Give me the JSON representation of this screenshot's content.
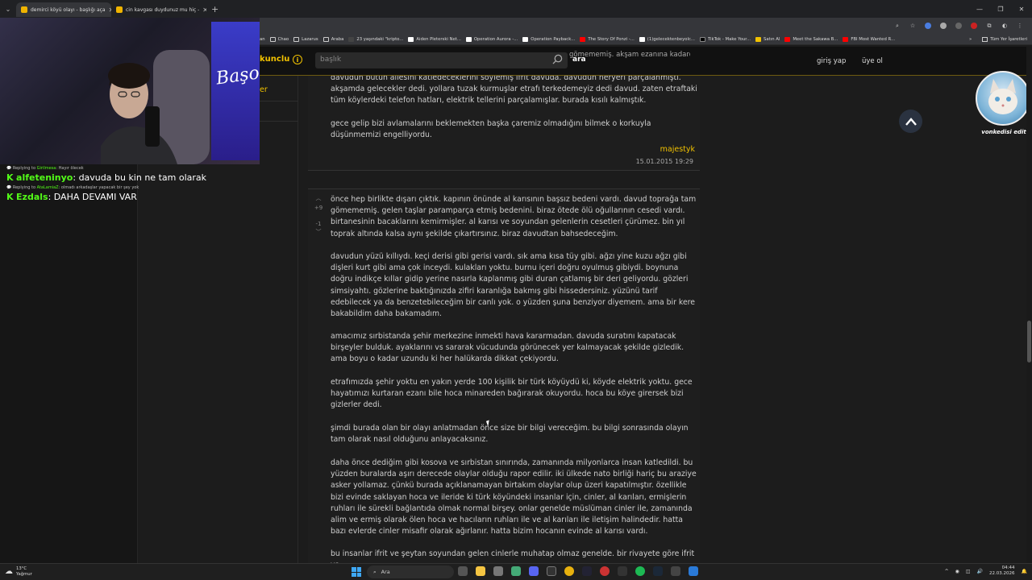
{
  "browser": {
    "tabs": [
      {
        "label": "demirci köyü olayı - başlığı aça",
        "active": true
      },
      {
        "label": "cin kavgası duydunuz mu hiç - ",
        "active": false
      }
    ],
    "new_tab": "+",
    "window_controls": [
      "—",
      "❐",
      "✕"
    ],
    "bookmarks": [
      {
        "label": "an",
        "color": "#888888"
      },
      {
        "label": "Chao",
        "color": "#cccccc"
      },
      {
        "label": "Lazarus",
        "color": "#cccccc"
      },
      {
        "label": "Araba",
        "color": "#cccccc"
      },
      {
        "label": "23 yaşındaki \"kripto...",
        "color": "#444444"
      },
      {
        "label": "Aiden Pleterski Net...",
        "color": "#ffffff"
      },
      {
        "label": "Operation Aurora -...",
        "color": "#ffffff"
      },
      {
        "label": "Operation Payback...",
        "color": "#ffffff"
      },
      {
        "label": "The Story Of Ponzi -...",
        "color": "#ff0000"
      },
      {
        "label": "(1)gelecektenbeyolc...",
        "color": "#ffffff"
      },
      {
        "label": "TikTok - Make Your...",
        "color": "#000000"
      },
      {
        "label": "Satın Al",
        "color": "#f2c200"
      },
      {
        "label": "Meet the Sakawa B...",
        "color": "#ff0000"
      },
      {
        "label": "FBI Most Wanted R...",
        "color": "#ff0000"
      }
    ],
    "bookmarks_more": "»",
    "all_bookmarks": "Tüm Yer İşaretleri"
  },
  "site": {
    "logo_fragment": "kunclu",
    "search_placeholder": "başlık",
    "search_button": "ara",
    "login": "giriş yap",
    "signup": "üye ol",
    "sidebar_fragment": "er",
    "accent": "#f2c200"
  },
  "stream": {
    "cam_logo": "Başo",
    "chat": [
      {
        "reply_prefix": "Replying to",
        "reply_user": "Girilmesa",
        "reply_text": "Hayır ölecek",
        "user": "alfeteninyo",
        "text": "davuda bu kin ne tam olarak"
      },
      {
        "reply_prefix": "Replying to",
        "reply_user": "AtaLamiaZ",
        "reply_text": "olmadı arkadaşlar yapacak bir şey yok",
        "user": "Ezdals",
        "text": "DAHA DEVAMI VAR"
      }
    ]
  },
  "entry1": {
    "overlap_text": "gömememiş. akşam ezanına kadarda\n...a öldürüp yakacaklarını ve",
    "para1": "davudun bütün ailesini katledeceklerini söylemiş ifrit davuda. davudun heryeri parçalanmıştı. akşamda gelecekler dedi. yollara tuzak kurmuşlar etrafı terkedemeyiz dedi davud. zaten etraftaki tüm köylerdeki telefon hatları, elektrik tellerini parçalamışlar. burada kısılı kalmıştık.",
    "para2": "gece gelip bizi avlamalarını beklemekten başka çaremiz olmadığını bilmek o korkuyla düşünmemizi engelliyordu.",
    "author": "majestyk",
    "date": "15.01.2015 19:29"
  },
  "entry2": {
    "vote_up_count": "+9",
    "vote_down_count": "-1",
    "paragraphs": [
      "önce hep birlikte dışarı çıktık. kapının önünde al karısının başsız bedeni vardı. davud toprağa tam gömememiş. gelen taşlar paramparça etmiş bedenini. biraz ötede ölü oğullarının cesedi vardı. birtanesinin bacaklarını kemirmişler. al karısı ve soyundan gelenlerin cesetleri çürümez. bin yıl toprak altında kalsa aynı şekilde çıkartırsınız. biraz davudtan bahsedeceğim.",
      "davudun yüzü kıllıydı. keçi derisi gibi gerisi vardı. sık ama kısa tüy gibi. ağzı yine kuzu ağzı gibi dişleri kurt gibi ama çok inceydi. kulakları yoktu. burnu içeri doğru oyulmuş gibiydi. boynuna doğru indikçe kıllar gidip yerine nasırla kaplanmış gibi duran çatlamış bir deri geliyordu. gözleri simsiyahtı. gözlerine baktığınızda zifiri karanlığa bakmış gibi hissedersiniz. yüzünü tarif edebilecek ya da benzetebileceğim bir canlı yok. o yüzden şuna benziyor diyemem. ama bir kere bakabildim daha bakamadım.",
      "amacımız sırbistanda şehir merkezine inmekti hava kararmadan. davuda suratını kapatacak birşeyler bulduk. ayaklarını vs sararak vücudunda görünecek yer kalmayacak şekilde gizledik. ama boyu o kadar uzundu ki her halükarda dikkat çekiyordu.",
      "etrafımızda şehir yoktu en yakın yerde 100 kişilik bir türk köyüydü ki, köyde elektrik yoktu. gece hayatımızı kurtaran ezanı bile hoca minareden bağırarak okuyordu. hoca bu köye girersek bizi gizlerler dedi.",
      "şimdi burada olan bir olayı anlatmadan önce size bir bilgi vereceğim. bu bilgi sonrasında olayın tam olarak nasıl olduğunu anlayacaksınız.",
      "daha önce dediğim gibi kosova ve sırbistan sınırında, zamanında milyonlarca insan katledildi. bu yüzden buralarda aşırı derecede olaylar olduğu rapor edilir. iki ülkede nato birliği hariç bu araziye asker yollamaz. çünkü burada açıklanamayan birtakım olaylar olup üzeri kapatılmıştır. özellikle bizi evinde saklayan hoca ve ileride ki türk köyündeki insanlar için, cinler, al karıları, ermişlerin ruhları ile sürekli bağlantıda olmak normal birşey. onlar genelde müslüman cinler ile, zamanında alim ve ermiş olarak ölen hoca ve hacıların ruhları ile ve al karıları ile iletişim halindedir. hatta bazı evlerde cinler misafir olarak ağırlanır. hatta bizim hocanın evinde al karısı vardı.",
      "bu insanlar ifrit ve şeytan soyundan gelen cinlerle muhatap olmaz genelde. bir rivayete göre ifrit ya"
    ]
  },
  "overlay": {
    "cat_caption": "vonkedisi edit"
  },
  "taskbar": {
    "temp": "13°C",
    "weather": "Yağmur",
    "search": "Ara",
    "time": "04:44",
    "date": "22.03.2026"
  }
}
